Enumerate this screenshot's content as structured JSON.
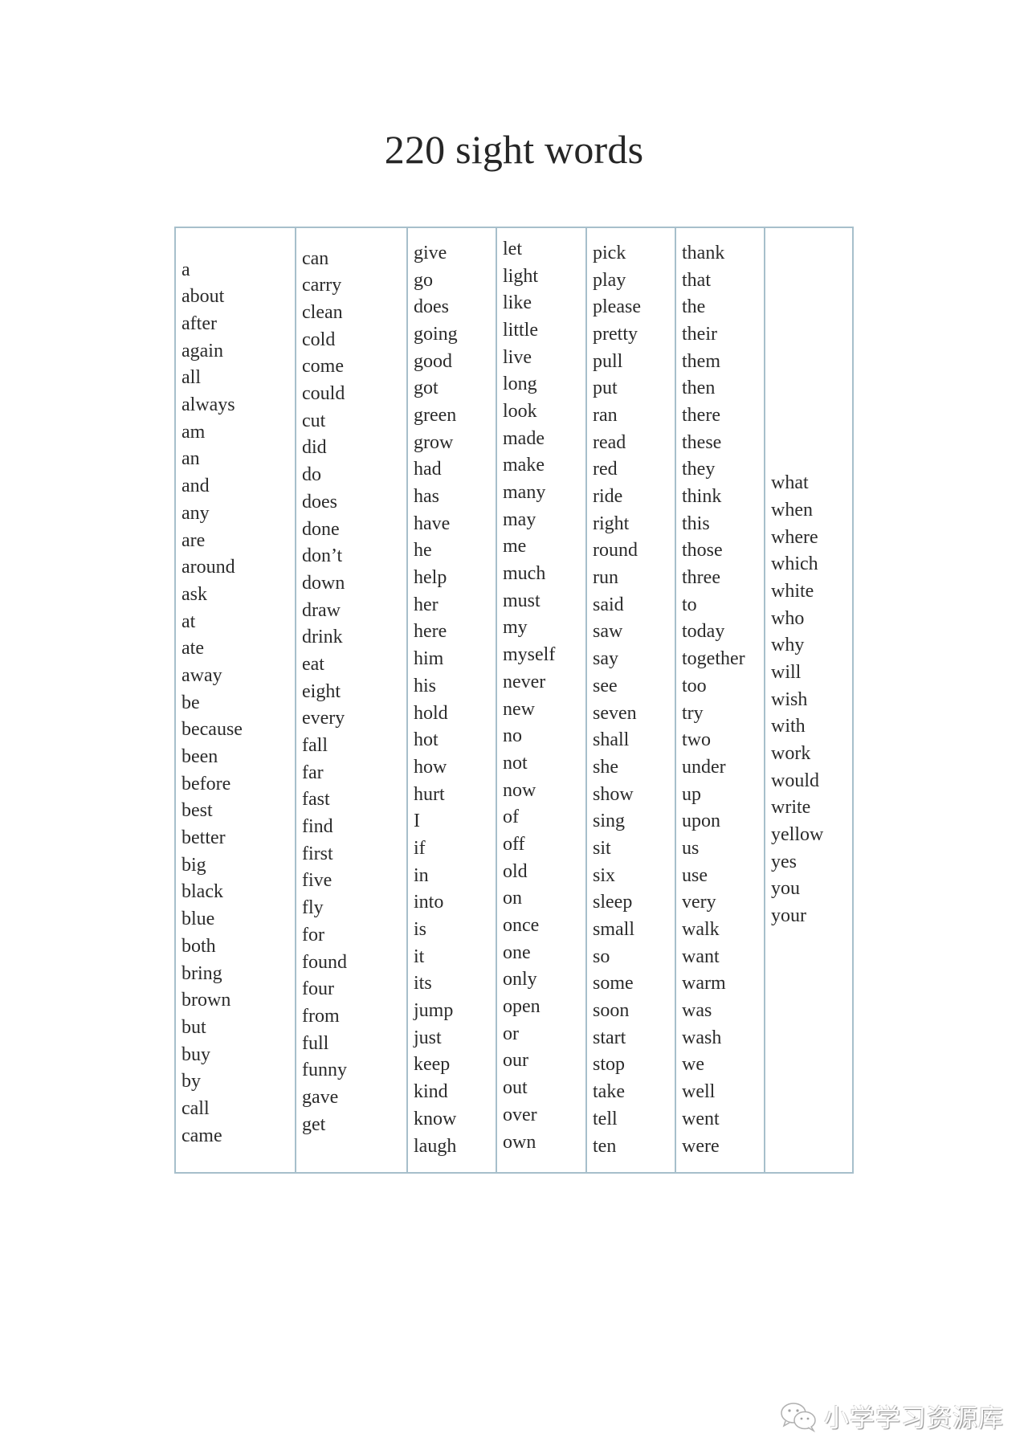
{
  "title": "220 sight words",
  "columns": [
    [
      "a",
      "about",
      "after",
      "again",
      "all",
      "always",
      "am",
      "an",
      "and",
      "any",
      "are",
      "around",
      "ask",
      "at",
      "ate",
      "away",
      "be",
      "because",
      "been",
      "before",
      "best",
      "better",
      "big",
      "black",
      "blue",
      "both",
      "bring",
      "brown",
      "but",
      "buy",
      "by",
      "call",
      "came"
    ],
    [
      "can",
      "carry",
      "clean",
      "cold",
      "come",
      "could",
      "cut",
      "did",
      "do",
      "does",
      "done",
      "don’t",
      "down",
      "draw",
      "drink",
      "eat",
      "eight",
      "every",
      "fall",
      "far",
      "fast",
      "find",
      "first",
      "five",
      "fly",
      "for",
      "found",
      "four",
      "from",
      "full",
      "funny",
      "gave",
      "get"
    ],
    [
      "give",
      "go",
      "does",
      "going",
      "good",
      "got",
      "green",
      "grow",
      "had",
      "has",
      "have",
      "he",
      "help",
      "her",
      "here",
      "him",
      "his",
      "hold",
      "hot",
      "how",
      "hurt",
      "I",
      "if",
      "in",
      "into",
      "is",
      "it",
      "its",
      "jump",
      "just",
      "keep",
      "kind",
      "know",
      "laugh"
    ],
    [
      "let",
      "light",
      "like",
      "little",
      "live",
      "long",
      "look",
      "made",
      "make",
      "many",
      "may",
      "me",
      "much",
      "must",
      "my",
      "myself",
      "never",
      "new",
      "no",
      "not",
      "now",
      "of",
      "off",
      "old",
      "on",
      "once",
      "one",
      "only",
      "open",
      "or",
      "our",
      "out",
      "over",
      "own"
    ],
    [
      "pick",
      "play",
      "please",
      "pretty",
      "pull",
      "put",
      "ran",
      "read",
      "red",
      "ride",
      "right",
      "round",
      "run",
      "said",
      "saw",
      "say",
      "see",
      "seven",
      "shall",
      "she",
      "show",
      "sing",
      "sit",
      "six",
      "sleep",
      "small",
      "so",
      "some",
      "soon",
      "start",
      "stop",
      "take",
      "tell",
      "ten"
    ],
    [
      "thank",
      "that",
      "the",
      "their",
      "them",
      "then",
      "there",
      "these",
      "they",
      "think",
      "this",
      "those",
      "three",
      "to",
      "today",
      "together",
      "too",
      "try",
      "two",
      "under",
      "up",
      "upon",
      "us",
      "use",
      "very",
      "walk",
      "want",
      "warm",
      "was",
      "wash",
      "we",
      "well",
      "went",
      "were"
    ],
    [
      "what",
      "when",
      "where",
      "which",
      "white",
      "who",
      "why",
      "will",
      "wish",
      "with",
      "work",
      "would",
      "write",
      "yellow",
      "yes",
      "you",
      "your"
    ]
  ],
  "watermark": {
    "icon": "wechat-icon",
    "text": "小学学习资源库"
  },
  "colors": {
    "border": "#a7bfcb",
    "text": "#2b2b2b"
  }
}
